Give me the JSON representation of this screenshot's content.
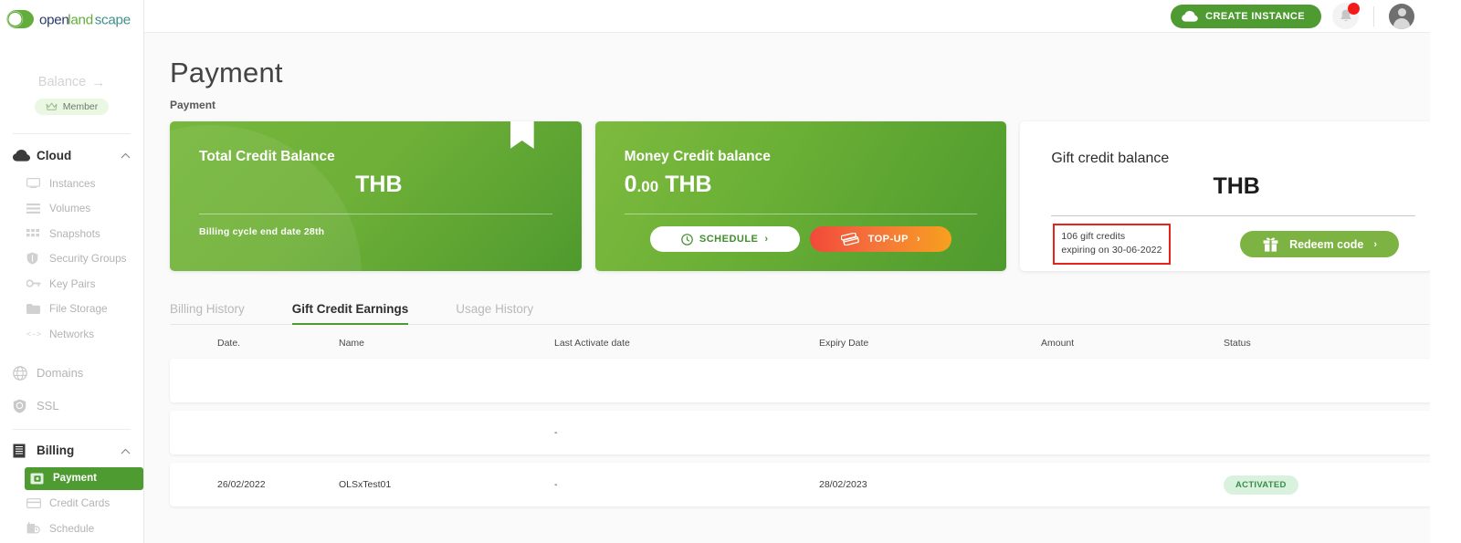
{
  "brand": {
    "logo_text_parts": [
      "open",
      "land",
      "scape"
    ],
    "logo_full": "openlandscape",
    "accent_green": "#4d9b31",
    "accent_light_green": "#7cb342"
  },
  "sidebar": {
    "balance": {
      "label": "Balance",
      "arrow": "→"
    },
    "member_badge": {
      "label": "Member",
      "icon": "crown-icon"
    },
    "groups": [
      {
        "label": "Cloud",
        "icon": "cloud-icon",
        "expanded": true,
        "chevron": "chevron-up-icon",
        "items": [
          {
            "label": "Instances",
            "icon": "monitor-icon"
          },
          {
            "label": "Volumes",
            "icon": "layers-icon"
          },
          {
            "label": "Snapshots",
            "icon": "grid-icon"
          },
          {
            "label": "Security Groups",
            "icon": "shield-icon"
          },
          {
            "label": "Key Pairs",
            "icon": "key-icon"
          },
          {
            "label": "File Storage",
            "icon": "folder-icon"
          },
          {
            "label": "Networks",
            "icon": "code-brackets-icon"
          }
        ]
      }
    ],
    "standalone": [
      {
        "label": "Domains",
        "icon": "globe-icon"
      },
      {
        "label": "SSL",
        "icon": "shield-check-icon"
      }
    ],
    "billing": {
      "label": "Billing",
      "icon": "receipt-icon",
      "expanded": true,
      "chevron": "chevron-up-icon",
      "items": [
        {
          "label": "Payment",
          "icon": "wallet-icon",
          "active": true
        },
        {
          "label": "Credit Cards",
          "icon": "credit-card-icon",
          "active": false
        },
        {
          "label": "Schedule",
          "icon": "calendar-clock-icon",
          "active": false
        }
      ]
    }
  },
  "topbar": {
    "create_instance_label": "CREATE INSTANCE",
    "create_instance_icon": "cloud-icon",
    "bell_icon": "bell-icon",
    "bell_has_notification": true,
    "avatar_icon": "user-avatar",
    "chevron_icon": "chevron-down-icon"
  },
  "page": {
    "title": "Payment",
    "breadcrumb": "Payment"
  },
  "cards": {
    "total_credit": {
      "label": "Total Credit Balance",
      "amount": "",
      "currency": "THB",
      "note": "Billing cycle end date 28th",
      "ribbon_icon": "bookmark-icon"
    },
    "money_credit": {
      "label": "Money Credit balance",
      "amount_int": "0",
      "amount_dec": ".00",
      "currency": "THB",
      "schedule_button": {
        "label": "SCHEDULE",
        "icon": "clock-icon",
        "chevron": "›"
      },
      "topup_button": {
        "label": "TOP-UP",
        "icon": "credit-card-stack-icon",
        "chevron": "›"
      }
    },
    "gift_credit": {
      "label": "Gift credit balance",
      "amount": "",
      "currency": "THB",
      "note_line1": "106 gift credits",
      "note_line2": "expiring on 30-06-2022",
      "note_highlight_color": "#e8231c",
      "redeem_button": {
        "label": "Redeem code",
        "icon": "gift-icon",
        "chevron": "›"
      }
    }
  },
  "tabs": [
    {
      "label": "Billing History",
      "active": false
    },
    {
      "label": "Gift Credit Earnings",
      "active": true
    },
    {
      "label": "Usage History",
      "active": false
    }
  ],
  "table": {
    "columns": [
      "Date.",
      "Name",
      "Last Activate date",
      "Expiry Date",
      "Amount",
      "Status"
    ],
    "rows": [
      {
        "date": "",
        "name": "",
        "last_activate": "",
        "expiry": "",
        "amount": "",
        "status": ""
      },
      {
        "date": "",
        "name": "",
        "last_activate": "-",
        "expiry": "",
        "amount": "",
        "status": ""
      },
      {
        "date": "26/02/2022",
        "name": "OLSxTest01",
        "last_activate": "-",
        "expiry": "28/02/2023",
        "amount": "",
        "status": "ACTIVATED"
      }
    ]
  }
}
